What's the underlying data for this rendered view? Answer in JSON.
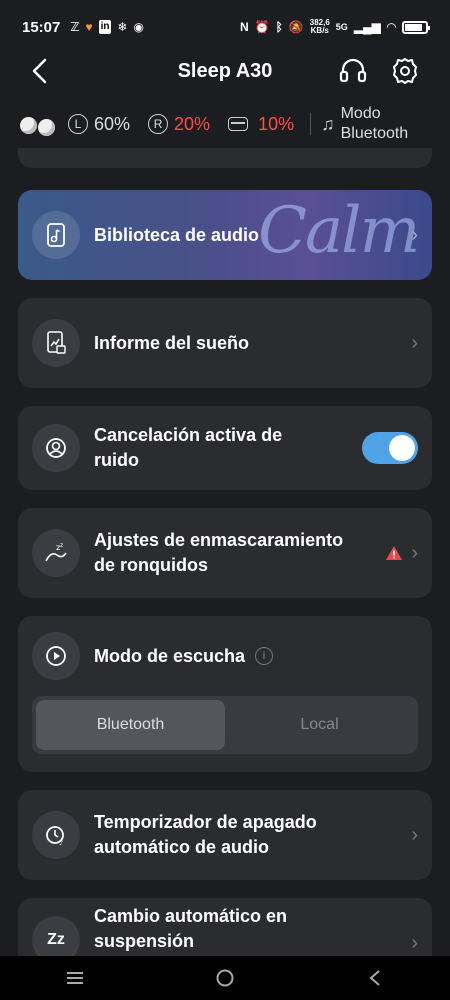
{
  "status_bar": {
    "time": "15:07",
    "left_icons": [
      "z-icon",
      "heart-icon",
      "linkedin-icon",
      "snowflake-icon",
      "app-icon"
    ],
    "speed_value": "382,6",
    "speed_unit": "KB/s",
    "network": "5G"
  },
  "header": {
    "title": "Sleep A30"
  },
  "battery": {
    "left_label": "L",
    "left_pct": "60%",
    "right_label": "R",
    "right_pct": "20%",
    "case_pct": "10%",
    "mode_line1": "Modo",
    "mode_line2": "Bluetooth"
  },
  "menu": {
    "audio_library": "Biblioteca de audio",
    "calm_brand": "Calm",
    "sleep_report": "Informe del sueño",
    "anc_line1": "Cancelación activa de",
    "anc_line2": "ruido",
    "anc_enabled": true,
    "snore_line1": "Ajustes de enmascaramiento",
    "snore_line2": "de ronquidos",
    "listen_mode": "Modo de escucha",
    "listen_options": [
      "Bluetooth",
      "Local"
    ],
    "listen_selected": "Bluetooth",
    "timer_line1": "Temporizador de apagado",
    "timer_line2": "automático de audio",
    "auto_line1": "Cambio automático en",
    "auto_line2": "suspensión"
  },
  "colors": {
    "background": "#1c1d20",
    "card": "#2b2c30",
    "accent_toggle": "#4fa3e6",
    "low_battery": "#ff4b4b"
  }
}
